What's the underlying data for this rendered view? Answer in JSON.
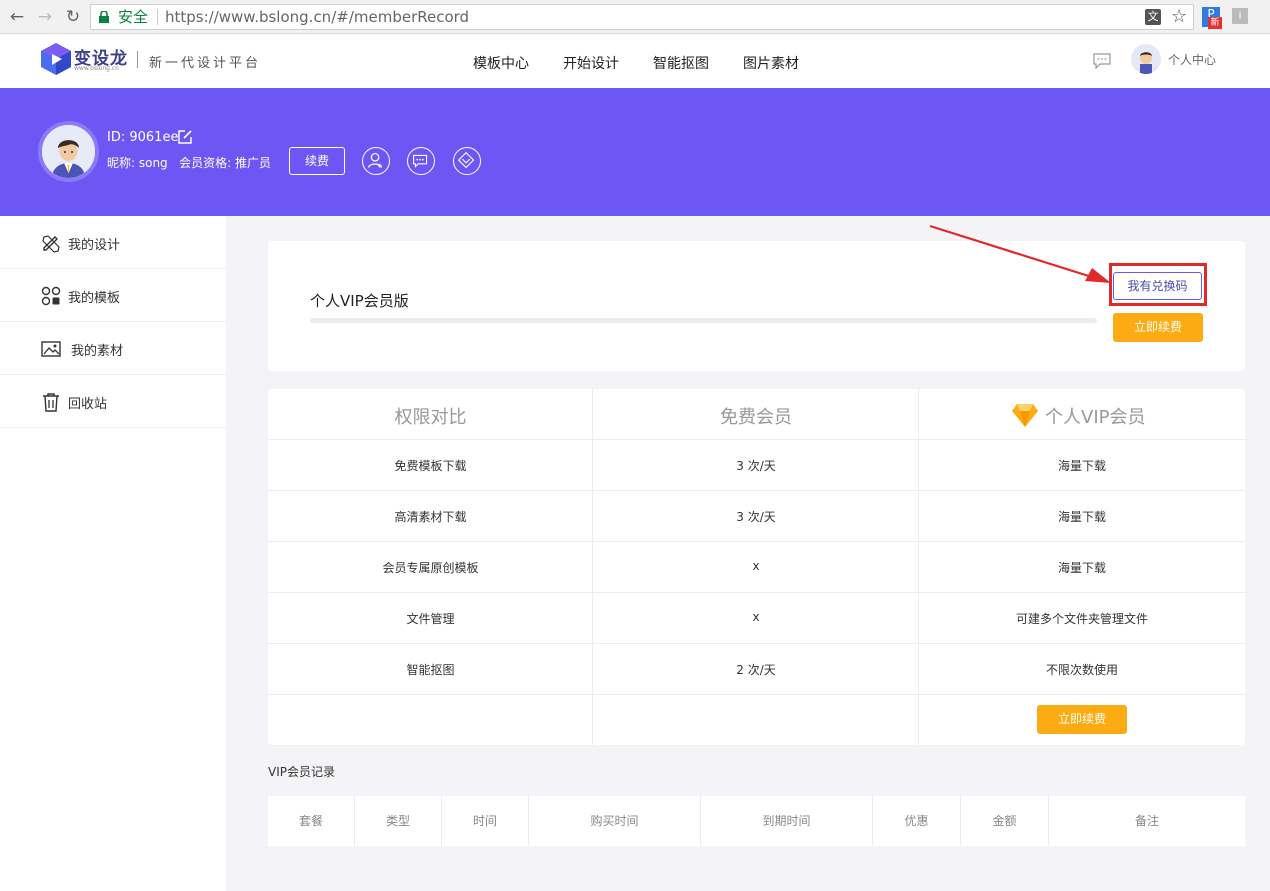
{
  "browser": {
    "secure_label": "安全",
    "url_scheme": "https://",
    "url": "https://www.bslong.cn/#/memberRecord",
    "ext_new_badge": "新"
  },
  "header": {
    "logo_text": "变设龙",
    "logo_sub": "www.bslong.cn",
    "slogan": "新一代设计平台",
    "nav": [
      "模板中心",
      "开始设计",
      "智能抠图",
      "图片素材"
    ],
    "user_center": "个人中心"
  },
  "profile": {
    "id_text": "ID: 9061ee",
    "info_text": "昵称: song   会员资格: 推广员",
    "renew_label": "续费"
  },
  "sidebar": {
    "items": [
      {
        "label": "我的设计",
        "icon": "pencil-ruler-icon"
      },
      {
        "label": "我的模板",
        "icon": "shapes-icon"
      },
      {
        "label": "我的素材",
        "icon": "image-icon"
      },
      {
        "label": "回收站",
        "icon": "trash-icon"
      }
    ]
  },
  "vip_card": {
    "title": "个人VIP会员版",
    "redeem_label": "我有兑换码",
    "renew_now_label": "立即续费"
  },
  "compare": {
    "headers": [
      "权限对比",
      "免费会员",
      "个人VIP会员"
    ],
    "rows": [
      [
        "免费模板下载",
        "3 次/天",
        "海量下载"
      ],
      [
        "高清素材下载",
        "3 次/天",
        "海量下载"
      ],
      [
        "会员专属原创模板",
        "x",
        "海量下载"
      ],
      [
        "文件管理",
        "x",
        "可建多个文件夹管理文件"
      ],
      [
        "智能抠图",
        "2 次/天",
        "不限次数使用"
      ]
    ],
    "renew_now_label": "立即续费"
  },
  "records": {
    "title": "VIP会员记录",
    "columns": [
      "套餐",
      "类型",
      "时间",
      "购买时间",
      "到期时间",
      "优惠",
      "金额",
      "备注"
    ]
  },
  "colors": {
    "brand_purple": "#6c57f5",
    "accent_orange": "#fdab12",
    "highlight_red": "#e02a2a"
  }
}
